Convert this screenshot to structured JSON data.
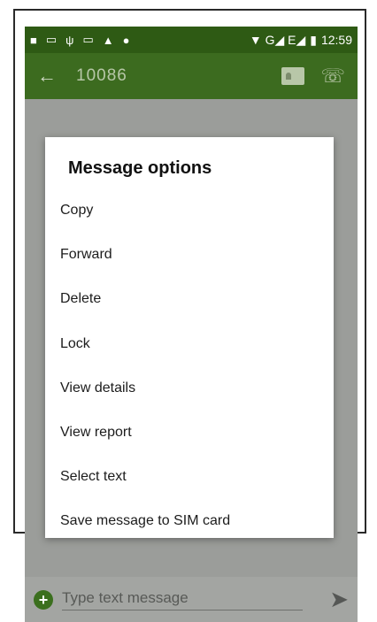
{
  "status_bar": {
    "left_icons": [
      "■",
      "▭",
      "ψ",
      "▭",
      "▲",
      "●"
    ],
    "network": "▼ G◢ E◢",
    "battery": "▮",
    "time": "12:59"
  },
  "app_bar": {
    "back": "←",
    "title": "10086",
    "call": "☏"
  },
  "dialog": {
    "title": "Message options",
    "options": [
      "Copy",
      "Forward",
      "Delete",
      "Lock",
      "View details",
      "View report",
      "Select text",
      "Save message to SIM card"
    ]
  },
  "composer": {
    "add": "+",
    "placeholder": "Type text message",
    "send": "➤"
  }
}
